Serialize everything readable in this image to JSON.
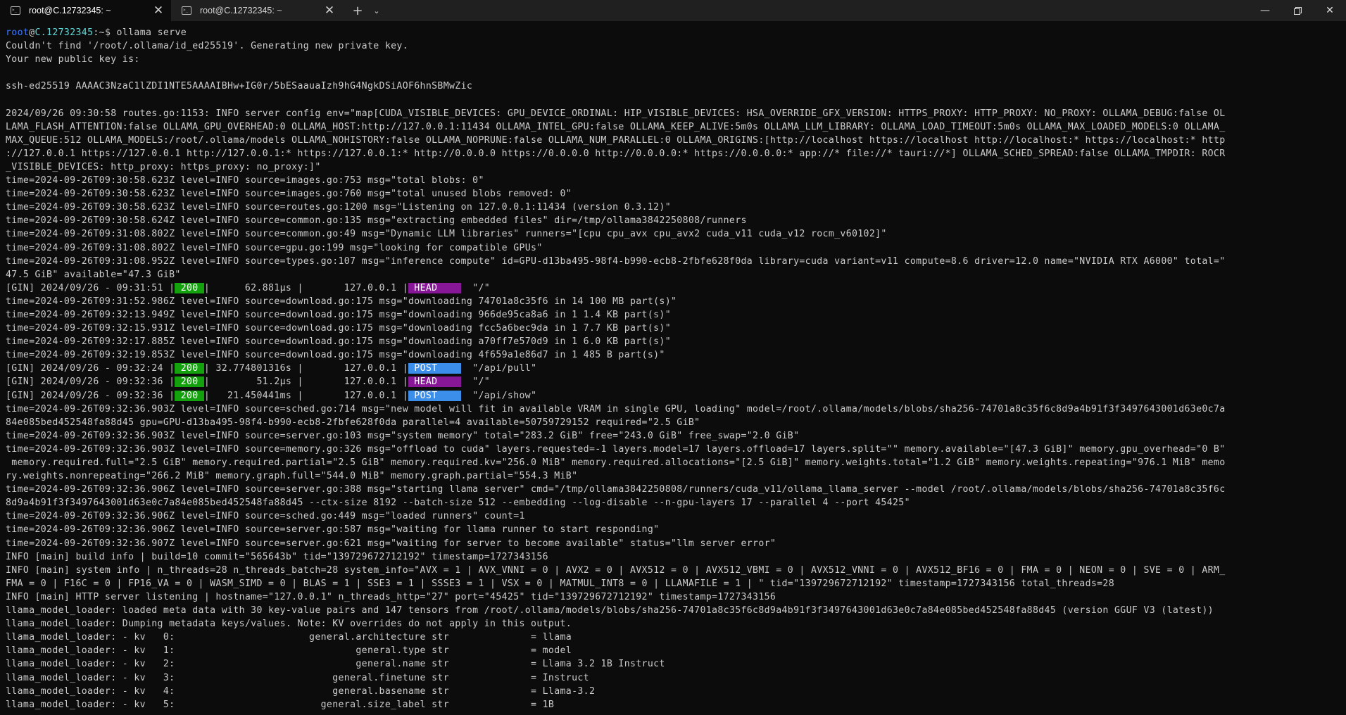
{
  "tabs": [
    {
      "title": "root@C.12732345: ~",
      "icon": "terminal-icon",
      "active": true
    },
    {
      "title": "root@C.12732345: ~",
      "icon": "terminal-icon",
      "active": false
    }
  ],
  "colors": {
    "background": "#0c0c0c",
    "titlebar": "#202020",
    "text": "#cccccc",
    "prompt_user": "#3b78ff",
    "prompt_host": "#61d6d6",
    "status_200": "#13a10e",
    "method_head": "#881798",
    "method_post": "#3b8eea"
  },
  "prompt": {
    "user": "root",
    "at": "@",
    "host": "C.12732345",
    "rest": ":~$ ",
    "command": "ollama serve"
  },
  "lines_a": [
    "Couldn't find '/root/.ollama/id_ed25519'. Generating new private key.",
    "Your new public key is:",
    "",
    "ssh-ed25519 AAAAC3NzaC1lZDI1NTE5AAAAIBHw+IG0r/5bESaauaIzh9hG4NgkDSiAOF6hnSBMwZic",
    "",
    "2024/09/26 09:30:58 routes.go:1153: INFO server config env=\"map[CUDA_VISIBLE_DEVICES: GPU_DEVICE_ORDINAL: HIP_VISIBLE_DEVICES: HSA_OVERRIDE_GFX_VERSION: HTTPS_PROXY: HTTP_PROXY: NO_PROXY: OLLAMA_DEBUG:false OL",
    "LAMA_FLASH_ATTENTION:false OLLAMA_GPU_OVERHEAD:0 OLLAMA_HOST:http://127.0.0.1:11434 OLLAMA_INTEL_GPU:false OLLAMA_KEEP_ALIVE:5m0s OLLAMA_LLM_LIBRARY: OLLAMA_LOAD_TIMEOUT:5m0s OLLAMA_MAX_LOADED_MODELS:0 OLLAMA_",
    "MAX_QUEUE:512 OLLAMA_MODELS:/root/.ollama/models OLLAMA_NOHISTORY:false OLLAMA_NOPRUNE:false OLLAMA_NUM_PARALLEL:0 OLLAMA_ORIGINS:[http://localhost https://localhost http://localhost:* https://localhost:* http",
    "://127.0.0.1 https://127.0.0.1 http://127.0.0.1:* https://127.0.0.1:* http://0.0.0.0 https://0.0.0.0 http://0.0.0.0:* https://0.0.0.0:* app://* file://* tauri://*] OLLAMA_SCHED_SPREAD:false OLLAMA_TMPDIR: ROCR",
    "_VISIBLE_DEVICES: http_proxy: https_proxy: no_proxy:]\"",
    "time=2024-09-26T09:30:58.623Z level=INFO source=images.go:753 msg=\"total blobs: 0\"",
    "time=2024-09-26T09:30:58.623Z level=INFO source=images.go:760 msg=\"total unused blobs removed: 0\"",
    "time=2024-09-26T09:30:58.623Z level=INFO source=routes.go:1200 msg=\"Listening on 127.0.0.1:11434 (version 0.3.12)\"",
    "time=2024-09-26T09:30:58.624Z level=INFO source=common.go:135 msg=\"extracting embedded files\" dir=/tmp/ollama3842250808/runners",
    "time=2024-09-26T09:31:08.802Z level=INFO source=common.go:49 msg=\"Dynamic LLM libraries\" runners=\"[cpu cpu_avx cpu_avx2 cuda_v11 cuda_v12 rocm_v60102]\"",
    "time=2024-09-26T09:31:08.802Z level=INFO source=gpu.go:199 msg=\"looking for compatible GPUs\"",
    "time=2024-09-26T09:31:08.952Z level=INFO source=types.go:107 msg=\"inference compute\" id=GPU-d13ba495-98f4-b990-ecb8-2fbfe628f0da library=cuda variant=v11 compute=8.6 driver=12.0 name=\"NVIDIA RTX A6000\" total=\"",
    "47.5 GiB\" available=\"47.3 GiB\""
  ],
  "gin_1": {
    "prefix": "[GIN] 2024/09/26 - 09:31:51 |",
    "status": " 200 ",
    "mid": "|      62.881µs |       127.0.0.1 |",
    "method": " HEAD    ",
    "path": "  \"/\""
  },
  "lines_b": [
    "time=2024-09-26T09:31:52.986Z level=INFO source=download.go:175 msg=\"downloading 74701a8c35f6 in 14 100 MB part(s)\"",
    "time=2024-09-26T09:32:13.949Z level=INFO source=download.go:175 msg=\"downloading 966de95ca8a6 in 1 1.4 KB part(s)\"",
    "time=2024-09-26T09:32:15.931Z level=INFO source=download.go:175 msg=\"downloading fcc5a6bec9da in 1 7.7 KB part(s)\"",
    "time=2024-09-26T09:32:17.885Z level=INFO source=download.go:175 msg=\"downloading a70ff7e570d9 in 1 6.0 KB part(s)\"",
    "time=2024-09-26T09:32:19.853Z level=INFO source=download.go:175 msg=\"downloading 4f659a1e86d7 in 1 485 B part(s)\""
  ],
  "gin_2": {
    "prefix": "[GIN] 2024/09/26 - 09:32:24 |",
    "status": " 200 ",
    "mid": "| 32.774801316s |       127.0.0.1 |",
    "method": " POST    ",
    "path": "  \"/api/pull\""
  },
  "gin_3": {
    "prefix": "[GIN] 2024/09/26 - 09:32:36 |",
    "status": " 200 ",
    "mid": "|        51.2µs |       127.0.0.1 |",
    "method": " HEAD    ",
    "path": "  \"/\""
  },
  "gin_4": {
    "prefix": "[GIN] 2024/09/26 - 09:32:36 |",
    "status": " 200 ",
    "mid": "|   21.450441ms |       127.0.0.1 |",
    "method": " POST    ",
    "path": "  \"/api/show\""
  },
  "lines_c": [
    "time=2024-09-26T09:32:36.903Z level=INFO source=sched.go:714 msg=\"new model will fit in available VRAM in single GPU, loading\" model=/root/.ollama/models/blobs/sha256-74701a8c35f6c8d9a4b91f3f3497643001d63e0c7a",
    "84e085bed452548fa88d45 gpu=GPU-d13ba495-98f4-b990-ecb8-2fbfe628f0da parallel=4 available=50759729152 required=\"2.5 GiB\"",
    "time=2024-09-26T09:32:36.903Z level=INFO source=server.go:103 msg=\"system memory\" total=\"283.2 GiB\" free=\"243.0 GiB\" free_swap=\"2.0 GiB\"",
    "time=2024-09-26T09:32:36.903Z level=INFO source=memory.go:326 msg=\"offload to cuda\" layers.requested=-1 layers.model=17 layers.offload=17 layers.split=\"\" memory.available=\"[47.3 GiB]\" memory.gpu_overhead=\"0 B\"",
    " memory.required.full=\"2.5 GiB\" memory.required.partial=\"2.5 GiB\" memory.required.kv=\"256.0 MiB\" memory.required.allocations=\"[2.5 GiB]\" memory.weights.total=\"1.2 GiB\" memory.weights.repeating=\"976.1 MiB\" memo",
    "ry.weights.nonrepeating=\"266.2 MiB\" memory.graph.full=\"544.0 MiB\" memory.graph.partial=\"554.3 MiB\"",
    "time=2024-09-26T09:32:36.906Z level=INFO source=server.go:388 msg=\"starting llama server\" cmd=\"/tmp/ollama3842250808/runners/cuda_v11/ollama_llama_server --model /root/.ollama/models/blobs/sha256-74701a8c35f6c",
    "8d9a4b91f3f3497643001d63e0c7a84e085bed452548fa88d45 --ctx-size 8192 --batch-size 512 --embedding --log-disable --n-gpu-layers 17 --parallel 4 --port 45425\"",
    "time=2024-09-26T09:32:36.906Z level=INFO source=sched.go:449 msg=\"loaded runners\" count=1",
    "time=2024-09-26T09:32:36.906Z level=INFO source=server.go:587 msg=\"waiting for llama runner to start responding\"",
    "time=2024-09-26T09:32:36.907Z level=INFO source=server.go:621 msg=\"waiting for server to become available\" status=\"llm server error\"",
    "INFO [main] build info | build=10 commit=\"565643b\" tid=\"139729672712192\" timestamp=1727343156",
    "INFO [main] system info | n_threads=28 n_threads_batch=28 system_info=\"AVX = 1 | AVX_VNNI = 0 | AVX2 = 0 | AVX512 = 0 | AVX512_VBMI = 0 | AVX512_VNNI = 0 | AVX512_BF16 = 0 | FMA = 0 | NEON = 0 | SVE = 0 | ARM_",
    "FMA = 0 | F16C = 0 | FP16_VA = 0 | WASM_SIMD = 0 | BLAS = 1 | SSE3 = 1 | SSSE3 = 1 | VSX = 0 | MATMUL_INT8 = 0 | LLAMAFILE = 1 | \" tid=\"139729672712192\" timestamp=1727343156 total_threads=28",
    "INFO [main] HTTP server listening | hostname=\"127.0.0.1\" n_threads_http=\"27\" port=\"45425\" tid=\"139729672712192\" timestamp=1727343156",
    "llama_model_loader: loaded meta data with 30 key-value pairs and 147 tensors from /root/.ollama/models/blobs/sha256-74701a8c35f6c8d9a4b91f3f3497643001d63e0c7a84e085bed452548fa88d45 (version GGUF V3 (latest))",
    "llama_model_loader: Dumping metadata keys/values. Note: KV overrides do not apply in this output.",
    "llama_model_loader: - kv   0:                       general.architecture str              = llama",
    "llama_model_loader: - kv   1:                               general.type str              = model",
    "llama_model_loader: - kv   2:                               general.name str              = Llama 3.2 1B Instruct",
    "llama_model_loader: - kv   3:                           general.finetune str              = Instruct",
    "llama_model_loader: - kv   4:                           general.basename str              = Llama-3.2",
    "llama_model_loader: - kv   5:                         general.size_label str              = 1B"
  ]
}
